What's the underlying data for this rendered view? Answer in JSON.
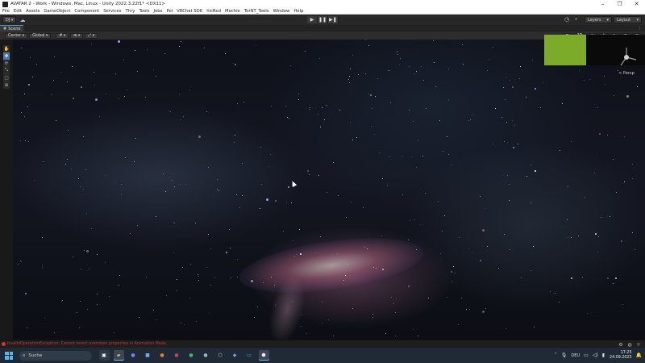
{
  "window": {
    "title": "AVATAR 2 - Work - Windows, Mac, Linux - Unity 2022.3.22f1* <DX11>",
    "minimize": "–",
    "maximize": "❐",
    "close": "✕"
  },
  "menu": [
    "File",
    "Edit",
    "Assets",
    "GameObject",
    "Component",
    "Services",
    "Thry",
    "Tools",
    "Jobs",
    "Poi",
    "VRChat SDK",
    "hlcRed",
    "Mochie",
    "TorNT_Tools",
    "Window",
    "Help"
  ],
  "toolbar": {
    "account": "DJ ▾",
    "cloud_icon": "cloud-icon",
    "play": "▶",
    "pause": "❚❚",
    "step": "▶❚",
    "history_icon": "history-icon",
    "search_icon": "search-icon",
    "layers": "Layers",
    "layout": "Layout"
  },
  "scene_tab": {
    "label": "Scene"
  },
  "scene_toolbar": {
    "pivot": "Center ▾",
    "space": "Global ▾",
    "grid": "# ▾",
    "snap": "⊞ ▾",
    "increment": "⤢ ▾"
  },
  "tools": [
    "✋",
    "✥",
    "⟳",
    "⤡",
    "▢",
    "⊕"
  ],
  "gizmo": {
    "label": "< Persp"
  },
  "status": {
    "message": "InvalidOperationException: Cannot revert overriden properties in Animation Mode."
  },
  "taskbar": {
    "search_placeholder": "Suche",
    "language": "DEU",
    "time": "17:25",
    "date": "24.09.2025"
  },
  "colors": {
    "accent": "#4a8fd0",
    "error": "#e03030",
    "preview_green": "#7cab2a"
  }
}
